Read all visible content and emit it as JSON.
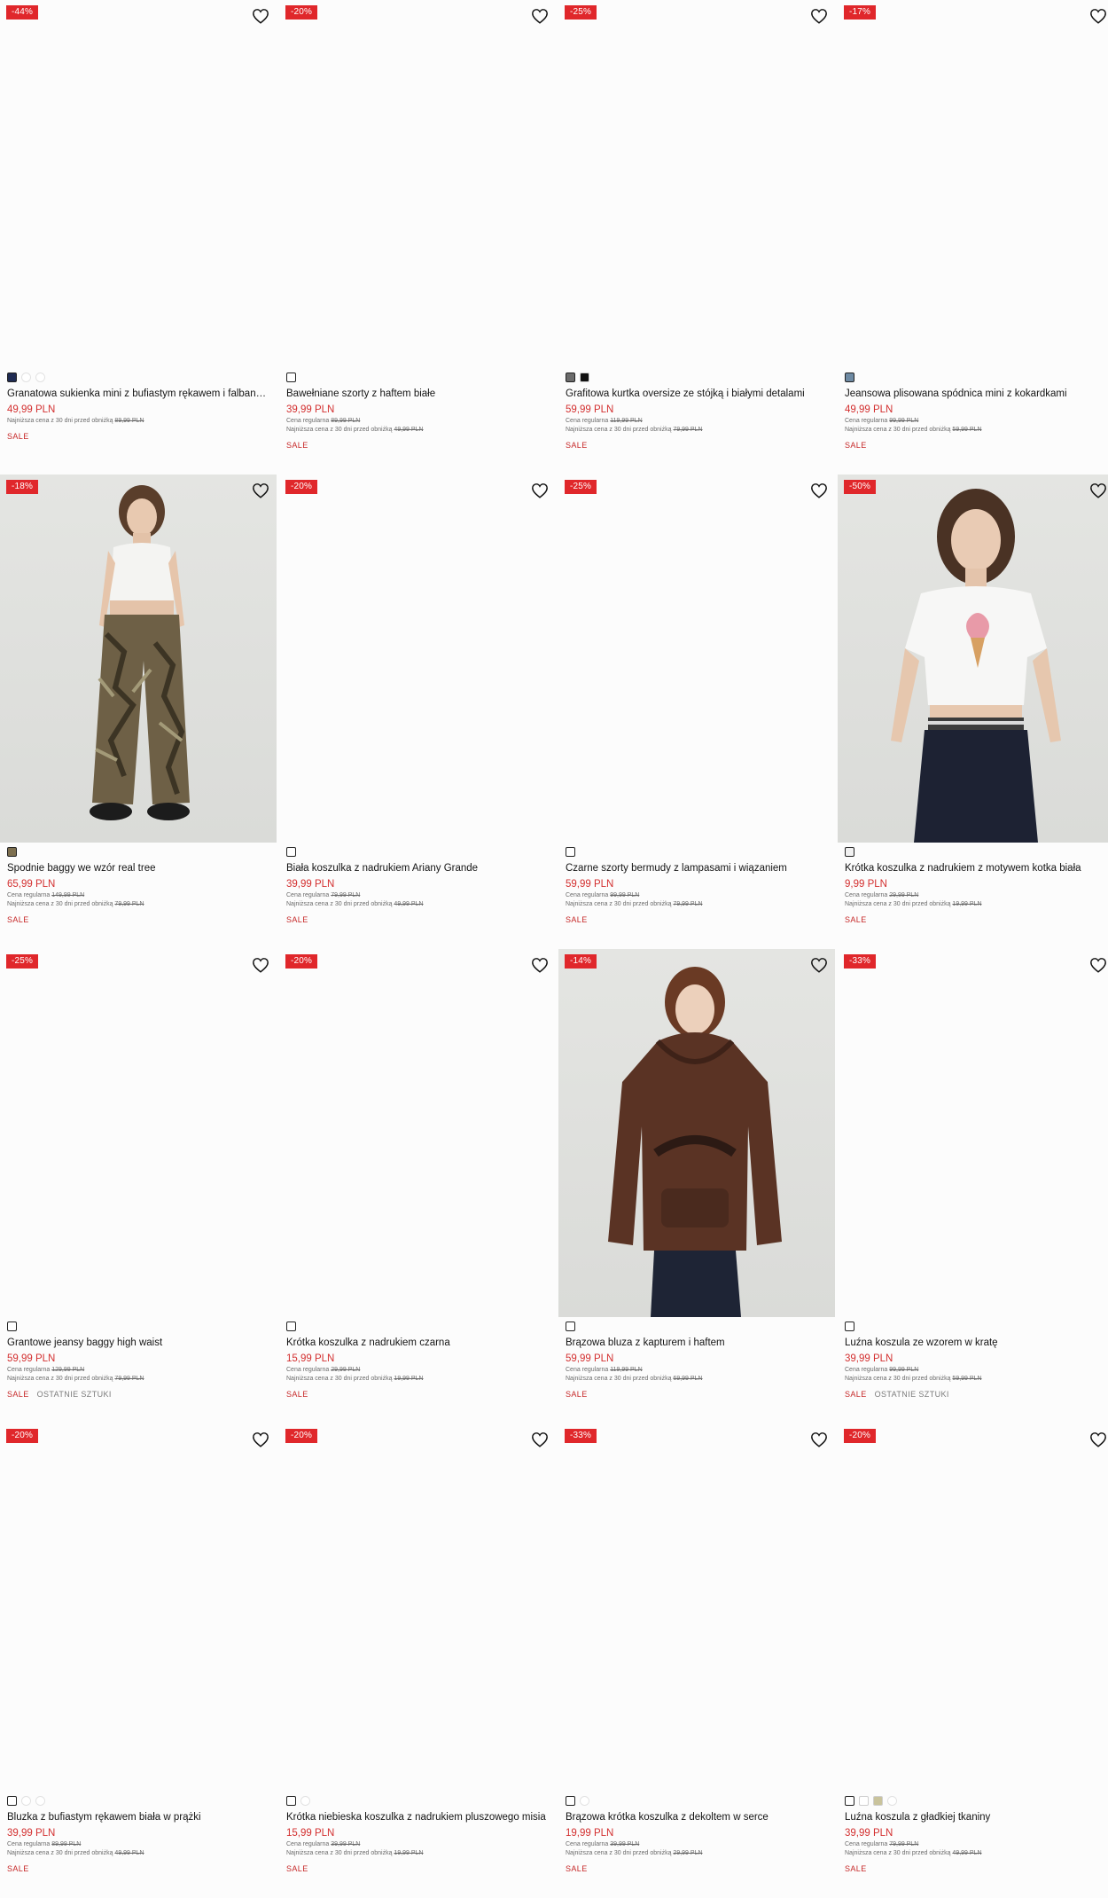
{
  "colors": {
    "badge_bg": "#e0272b",
    "price": "#d32f2f",
    "sale_tag": "#c62828"
  },
  "products": [
    {
      "badge": "-44%",
      "photo": false,
      "swatches": [
        {
          "color": "#1f2b52",
          "selected": true
        },
        {
          "color": "#ffffff",
          "selected": false,
          "circle": true
        },
        {
          "color": "#ffffff",
          "selected": false,
          "circle": true
        }
      ],
      "name": "Granatowa sukienka mini z bufiastym rękawem i falbanka...",
      "price": "49,99 PLN",
      "regular_label": "",
      "regular_price": "",
      "lowest_label": "Najniższa cena z 30 dni przed obniżką",
      "lowest_price": "89,99 PLN",
      "sale_label": "SALE",
      "last_label": ""
    },
    {
      "badge": "-20%",
      "photo": false,
      "swatches": [
        {
          "color": "#ffffff",
          "selected": true
        }
      ],
      "name": "Bawełniane szorty z haftem białe",
      "price": "39,99 PLN",
      "regular_label": "Cena regularna",
      "regular_price": "89,99 PLN",
      "lowest_label": "Najniższa cena z 30 dni przed obniżką",
      "lowest_price": "49,99 PLN",
      "sale_label": "SALE",
      "last_label": ""
    },
    {
      "badge": "-25%",
      "photo": false,
      "swatches": [
        {
          "color": "#6b6b6b",
          "selected": true
        },
        {
          "color": "#111111",
          "selected": false
        }
      ],
      "name": "Grafitowa kurtka oversize ze stójką i białymi detalami",
      "price": "59,99 PLN",
      "regular_label": "Cena regularna",
      "regular_price": "119,99 PLN",
      "lowest_label": "Najniższa cena z 30 dni przed obniżką",
      "lowest_price": "79,99 PLN",
      "sale_label": "SALE",
      "last_label": ""
    },
    {
      "badge": "-17%",
      "photo": false,
      "swatches": [
        {
          "color": "#6e8aa3",
          "selected": true
        }
      ],
      "name": "Jeansowa plisowana spódnica mini z kokardkami",
      "price": "49,99 PLN",
      "regular_label": "Cena regularna",
      "regular_price": "99,99 PLN",
      "lowest_label": "Najniższa cena z 30 dni przed obniżką",
      "lowest_price": "59,99 PLN",
      "sale_label": "SALE",
      "last_label": ""
    },
    {
      "badge": "-18%",
      "photo": true,
      "figure": "camo",
      "swatches": [
        {
          "color": "#7d6f4f",
          "selected": true
        }
      ],
      "name": "Spodnie baggy we wzór real tree",
      "price": "65,99 PLN",
      "regular_label": "Cena regularna",
      "regular_price": "149,99 PLN",
      "lowest_label": "Najniższa cena z 30 dni przed obniżką",
      "lowest_price": "79,99 PLN",
      "sale_label": "SALE",
      "last_label": ""
    },
    {
      "badge": "-20%",
      "photo": false,
      "swatches": [
        {
          "color": "#ffffff",
          "selected": true
        }
      ],
      "name": "Biała koszulka z nadrukiem Ariany Grande",
      "price": "39,99 PLN",
      "regular_label": "Cena regularna",
      "regular_price": "79,99 PLN",
      "lowest_label": "Najniższa cena z 30 dni przed obniżką",
      "lowest_price": "49,99 PLN",
      "sale_label": "SALE",
      "last_label": ""
    },
    {
      "badge": "-25%",
      "photo": false,
      "swatches": [
        {
          "color": "#ffffff",
          "selected": true
        }
      ],
      "name": "Czarne szorty bermudy z lampasami i wiązaniem",
      "price": "59,99 PLN",
      "regular_label": "Cena regularna",
      "regular_price": "99,99 PLN",
      "lowest_label": "Najniższa cena z 30 dni przed obniżką",
      "lowest_price": "79,99 PLN",
      "sale_label": "SALE",
      "last_label": ""
    },
    {
      "badge": "-50%",
      "photo": true,
      "figure": "tee",
      "swatches": [
        {
          "color": "#f1f1f1",
          "selected": true
        }
      ],
      "name": "Krótka koszulka z nadrukiem z motywem kotka biała",
      "price": "9,99 PLN",
      "regular_label": "Cena regularna",
      "regular_price": "29,99 PLN",
      "lowest_label": "Najniższa cena z 30 dni przed obniżką",
      "lowest_price": "19,99 PLN",
      "sale_label": "SALE",
      "last_label": ""
    },
    {
      "badge": "-25%",
      "photo": false,
      "swatches": [
        {
          "color": "#ffffff",
          "selected": true
        }
      ],
      "name": "Grantowe jeansy baggy high waist",
      "price": "59,99 PLN",
      "regular_label": "Cena regularna",
      "regular_price": "129,99 PLN",
      "lowest_label": "Najniższa cena z 30 dni przed obniżką",
      "lowest_price": "79,99 PLN",
      "sale_label": "SALE",
      "last_label": "OSTATNIE SZTUKI"
    },
    {
      "badge": "-20%",
      "photo": false,
      "swatches": [
        {
          "color": "#ffffff",
          "selected": true
        }
      ],
      "name": "Krótka koszulka z nadrukiem czarna",
      "price": "15,99 PLN",
      "regular_label": "Cena regularna",
      "regular_price": "29,99 PLN",
      "lowest_label": "Najniższa cena z 30 dni przed obniżką",
      "lowest_price": "19,99 PLN",
      "sale_label": "SALE",
      "last_label": ""
    },
    {
      "badge": "-14%",
      "photo": true,
      "figure": "hoodie",
      "swatches": [
        {
          "color": "#ffffff",
          "selected": true
        }
      ],
      "name": "Brązowa bluza z kapturem i haftem",
      "price": "59,99 PLN",
      "regular_label": "Cena regularna",
      "regular_price": "119,99 PLN",
      "lowest_label": "Najniższa cena z 30 dni przed obniżką",
      "lowest_price": "69,99 PLN",
      "sale_label": "SALE",
      "last_label": ""
    },
    {
      "badge": "-33%",
      "photo": false,
      "swatches": [
        {
          "color": "#ffffff",
          "selected": true
        }
      ],
      "name": "Luźna koszula ze wzorem w kratę",
      "price": "39,99 PLN",
      "regular_label": "Cena regularna",
      "regular_price": "99,99 PLN",
      "lowest_label": "Najniższa cena z 30 dni przed obniżką",
      "lowest_price": "59,99 PLN",
      "sale_label": "SALE",
      "last_label": "OSTATNIE SZTUKI"
    },
    {
      "badge": "-20%",
      "photo": false,
      "swatches": [
        {
          "color": "#ffffff",
          "selected": true
        },
        {
          "color": "#ffffff",
          "selected": false,
          "circle": true
        },
        {
          "color": "#ffffff",
          "selected": false,
          "circle": true
        }
      ],
      "name": "Bluzka z bufiastym rękawem biała w prążki",
      "price": "39,99 PLN",
      "regular_label": "Cena regularna",
      "regular_price": "89,99 PLN",
      "lowest_label": "Najniższa cena z 30 dni przed obniżką",
      "lowest_price": "49,99 PLN",
      "sale_label": "SALE",
      "last_label": ""
    },
    {
      "badge": "-20%",
      "photo": false,
      "swatches": [
        {
          "color": "#ffffff",
          "selected": true
        },
        {
          "color": "#ffffff",
          "selected": false,
          "circle": true
        }
      ],
      "name": "Krótka niebieska koszulka z nadrukiem pluszowego misia",
      "price": "15,99 PLN",
      "regular_label": "Cena regularna",
      "regular_price": "39,99 PLN",
      "lowest_label": "Najniższa cena z 30 dni przed obniżką",
      "lowest_price": "19,99 PLN",
      "sale_label": "SALE",
      "last_label": ""
    },
    {
      "badge": "-33%",
      "photo": false,
      "swatches": [
        {
          "color": "#ffffff",
          "selected": true
        },
        {
          "color": "#ffffff",
          "selected": false,
          "circle": true
        }
      ],
      "name": "Brązowa krótka koszulka z dekoltem w serce",
      "price": "19,99 PLN",
      "regular_label": "Cena regularna",
      "regular_price": "39,99 PLN",
      "lowest_label": "Najniższa cena z 30 dni przed obniżką",
      "lowest_price": "29,99 PLN",
      "sale_label": "SALE",
      "last_label": ""
    },
    {
      "badge": "-20%",
      "photo": false,
      "swatches": [
        {
          "color": "#ffffff",
          "selected": true
        },
        {
          "color": "#ffffff",
          "selected": false
        },
        {
          "color": "#c9c39c",
          "selected": false
        },
        {
          "color": "#ffffff",
          "selected": false,
          "circle": true
        }
      ],
      "name": "Luźna koszula z gładkiej tkaniny",
      "price": "39,99 PLN",
      "regular_label": "Cena regularna",
      "regular_price": "79,99 PLN",
      "lowest_label": "Najniższa cena z 30 dni przed obniżką",
      "lowest_price": "49,99 PLN",
      "sale_label": "SALE",
      "last_label": ""
    }
  ]
}
